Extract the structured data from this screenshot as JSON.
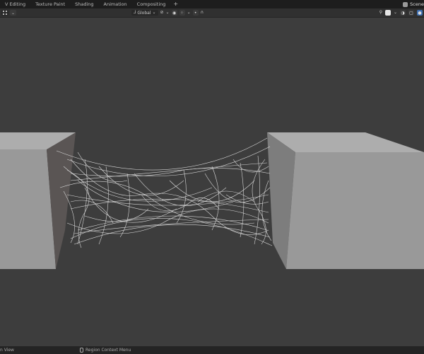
{
  "workspace_tabs": [
    "V Editing",
    "Texture Paint",
    "Shading",
    "Animation",
    "Compositing"
  ],
  "add_workspace": "+",
  "scene": {
    "label": "Scene"
  },
  "header": {
    "transform_orientation": "Global",
    "orientation_icon": "transform-orientation-icon",
    "snap_icon": "snap-icon",
    "proportional_icon": "proportional-edit-icon",
    "falloff_icon": "falloff-curve-icon"
  },
  "statusbar": {
    "left_text": "n View",
    "middle_text": "Region Context Menu"
  },
  "colors": {
    "viewport_bg": "#3d3d3d",
    "cube_front": "#999999",
    "cube_top": "#adadad",
    "cube_side": "#7d7d7d",
    "cube_inner": "#5a5554",
    "web": "#d8d8d8"
  }
}
